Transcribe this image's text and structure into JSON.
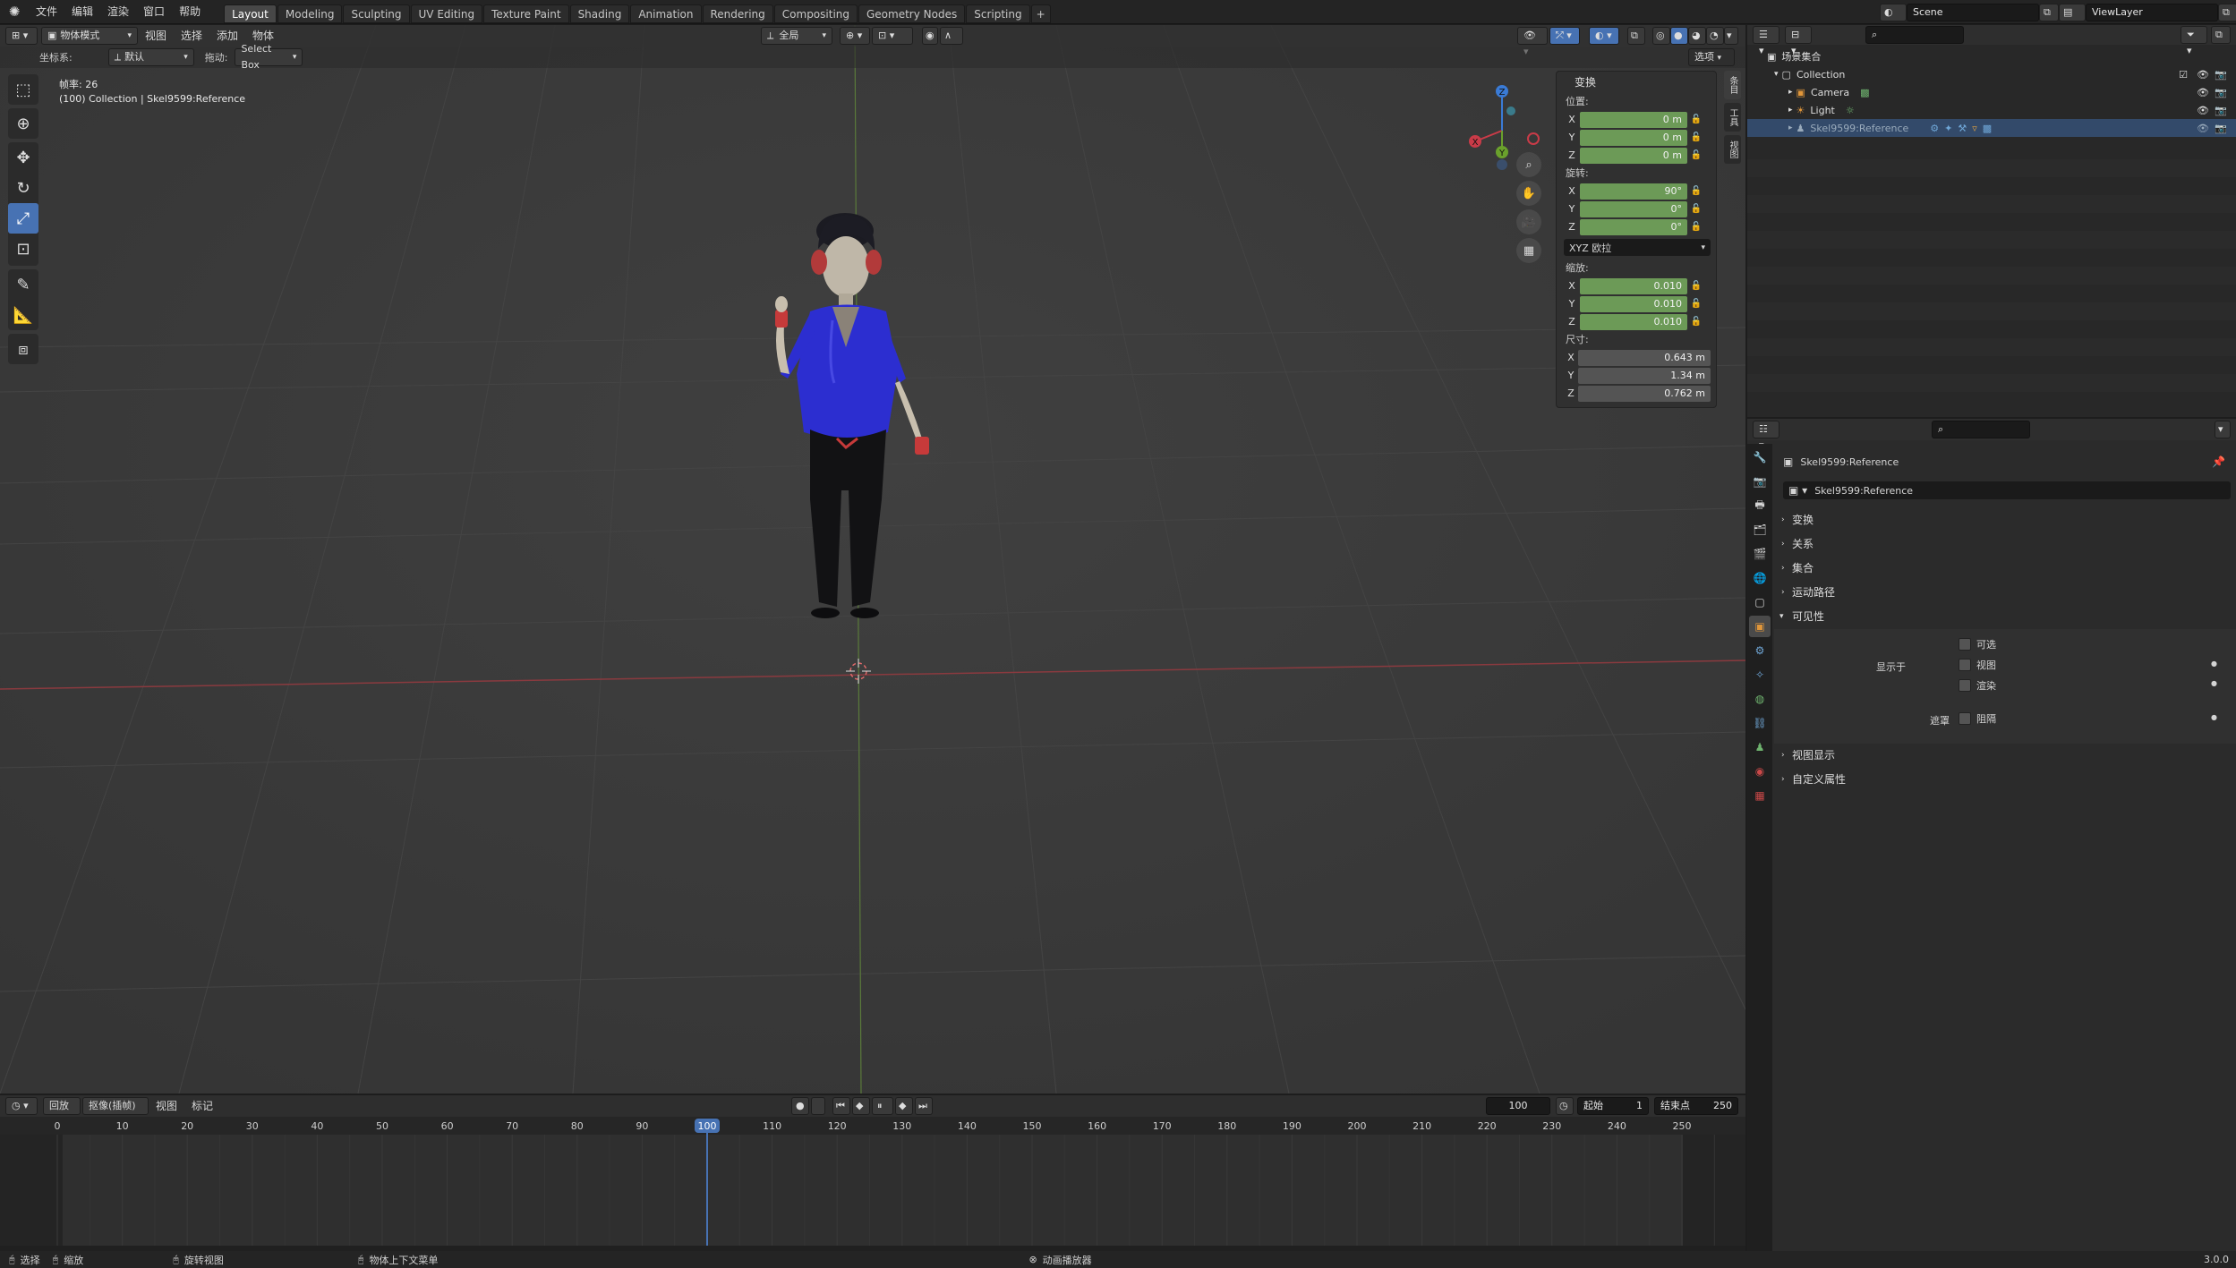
{
  "menu": {
    "items": [
      "文件",
      "编辑",
      "渲染",
      "窗口",
      "帮助"
    ]
  },
  "workspaces": {
    "tabs": [
      "Layout",
      "Modeling",
      "Sculpting",
      "UV Editing",
      "Texture Paint",
      "Shading",
      "Animation",
      "Rendering",
      "Compositing",
      "Geometry Nodes",
      "Scripting"
    ],
    "active": "Layout",
    "add": "+"
  },
  "scene": {
    "label": "Scene",
    "view_layer": "ViewLayer"
  },
  "viewport_header": {
    "mode": "物体模式",
    "menus": [
      "视图",
      "选择",
      "添加",
      "物体"
    ],
    "pivot": "全局"
  },
  "tool_settings": {
    "coord_label": "坐标系:",
    "coord_value": "默认",
    "drag_label": "拖动:",
    "drag_value": "Select Box",
    "options": "选项"
  },
  "overlay_text": {
    "fps": "帧率: 26",
    "context": "(100) Collection | Skel9599:Reference"
  },
  "gizmo": {
    "x": "X",
    "y": "Y",
    "z": "Z"
  },
  "npanel": {
    "title": "变换",
    "location_label": "位置:",
    "location": [
      {
        "axis": "X",
        "value": "0 m"
      },
      {
        "axis": "Y",
        "value": "0 m"
      },
      {
        "axis": "Z",
        "value": "0 m"
      }
    ],
    "rotation_label": "旋转:",
    "rotation": [
      {
        "axis": "X",
        "value": "90°"
      },
      {
        "axis": "Y",
        "value": "0°"
      },
      {
        "axis": "Z",
        "value": "0°"
      }
    ],
    "rotation_mode": "XYZ 欧拉",
    "scale_label": "缩放:",
    "scale": [
      {
        "axis": "X",
        "value": "0.010"
      },
      {
        "axis": "Y",
        "value": "0.010"
      },
      {
        "axis": "Z",
        "value": "0.010"
      }
    ],
    "dimensions_label": "尺寸:",
    "dimensions": [
      {
        "axis": "X",
        "value": "0.643 m"
      },
      {
        "axis": "Y",
        "value": "1.34 m"
      },
      {
        "axis": "Z",
        "value": "0.762 m"
      }
    ],
    "side_tabs": [
      "条目",
      "工具",
      "视图"
    ]
  },
  "outliner": {
    "root": "场景集合",
    "collection": "Collection",
    "items": [
      {
        "name": "Camera"
      },
      {
        "name": "Light"
      },
      {
        "name": "Skel9599:Reference"
      }
    ]
  },
  "properties": {
    "object_name": "Skel9599:Reference",
    "datablock": "Skel9599:Reference",
    "sections": [
      "变换",
      "关系",
      "集合",
      "运动路径",
      "可见性"
    ],
    "visibility": {
      "selectable": "可选",
      "show_in": "显示于",
      "viewports": "视图",
      "renders": "渲染",
      "mask": "遮罩",
      "holdout": "阻隔"
    },
    "sections_after": [
      "视图显示",
      "自定义属性"
    ]
  },
  "timeline": {
    "playback": "回放",
    "keying": "抠像(插帧)",
    "view": "视图",
    "marker": "标记",
    "current_frame": "100",
    "start_label": "起始",
    "start": "1",
    "end_label": "结束点",
    "end": "250",
    "ticks": [
      "0",
      "10",
      "20",
      "30",
      "40",
      "50",
      "60",
      "70",
      "80",
      "90",
      "100",
      "110",
      "120",
      "130",
      "140",
      "150",
      "160",
      "170",
      "180",
      "190",
      "200",
      "210",
      "220",
      "230",
      "240",
      "250"
    ]
  },
  "status": {
    "select": "选择",
    "pan": "缩放",
    "rotate": "旋转视图",
    "context_menu": "物体上下文菜单",
    "player": "动画播放器",
    "version": "3.0.0"
  },
  "colors": {
    "accent": "#4772b3",
    "field_green": "#6c9a57",
    "x_axis": "#c93b48",
    "y_axis": "#6aa12c",
    "z_axis": "#3a7bd6"
  }
}
